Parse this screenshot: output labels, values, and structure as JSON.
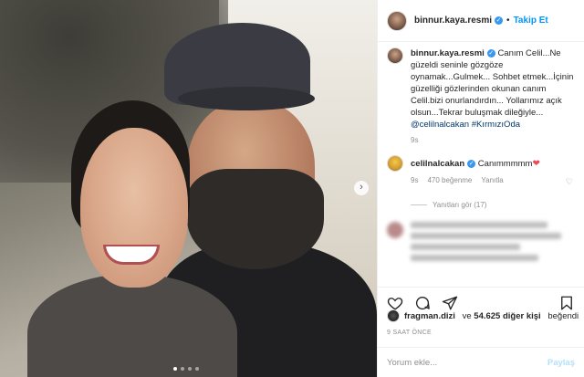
{
  "post": {
    "author": "binnur.kaya.resmi",
    "follow_label": "Takip Et",
    "separator": "•",
    "caption_text": "Canım Celil...Ne güzeldi seninle gözgöze oynamak...Gulmek... Sohbet etmek...İçinin güzelliği gözlerinden okunan canım Celil.bizi onurlandırdın... Yollarımız açık olsun...Tekrar buluşmak dileğiyle...",
    "caption_mention": "@celilnalcakan",
    "caption_hashtag": "#KırmızıOda",
    "caption_time": "9s"
  },
  "reply": {
    "author": "celilnalcakan",
    "text": "Canımmmmm",
    "time": "9s",
    "likes": "470 beğenme",
    "reply_label": "Yanıtla",
    "view_replies": "Yanıtları gör (17)"
  },
  "likes": {
    "user": "fragman.dizi",
    "connector": "ve",
    "count": "54.625 diğer kişi",
    "suffix": "beğendi"
  },
  "time_ago": "9 SAAT ÖNCE",
  "comment": {
    "placeholder": "Yorum ekle...",
    "post_label": "Paylaş"
  },
  "carousel": {
    "slides": 4,
    "active": 1,
    "next_icon": "chevron-right-icon"
  },
  "colors": {
    "link": "#00376b",
    "accent": "#0095f6",
    "verified": "#3897f0",
    "heart": "#ed4956"
  }
}
